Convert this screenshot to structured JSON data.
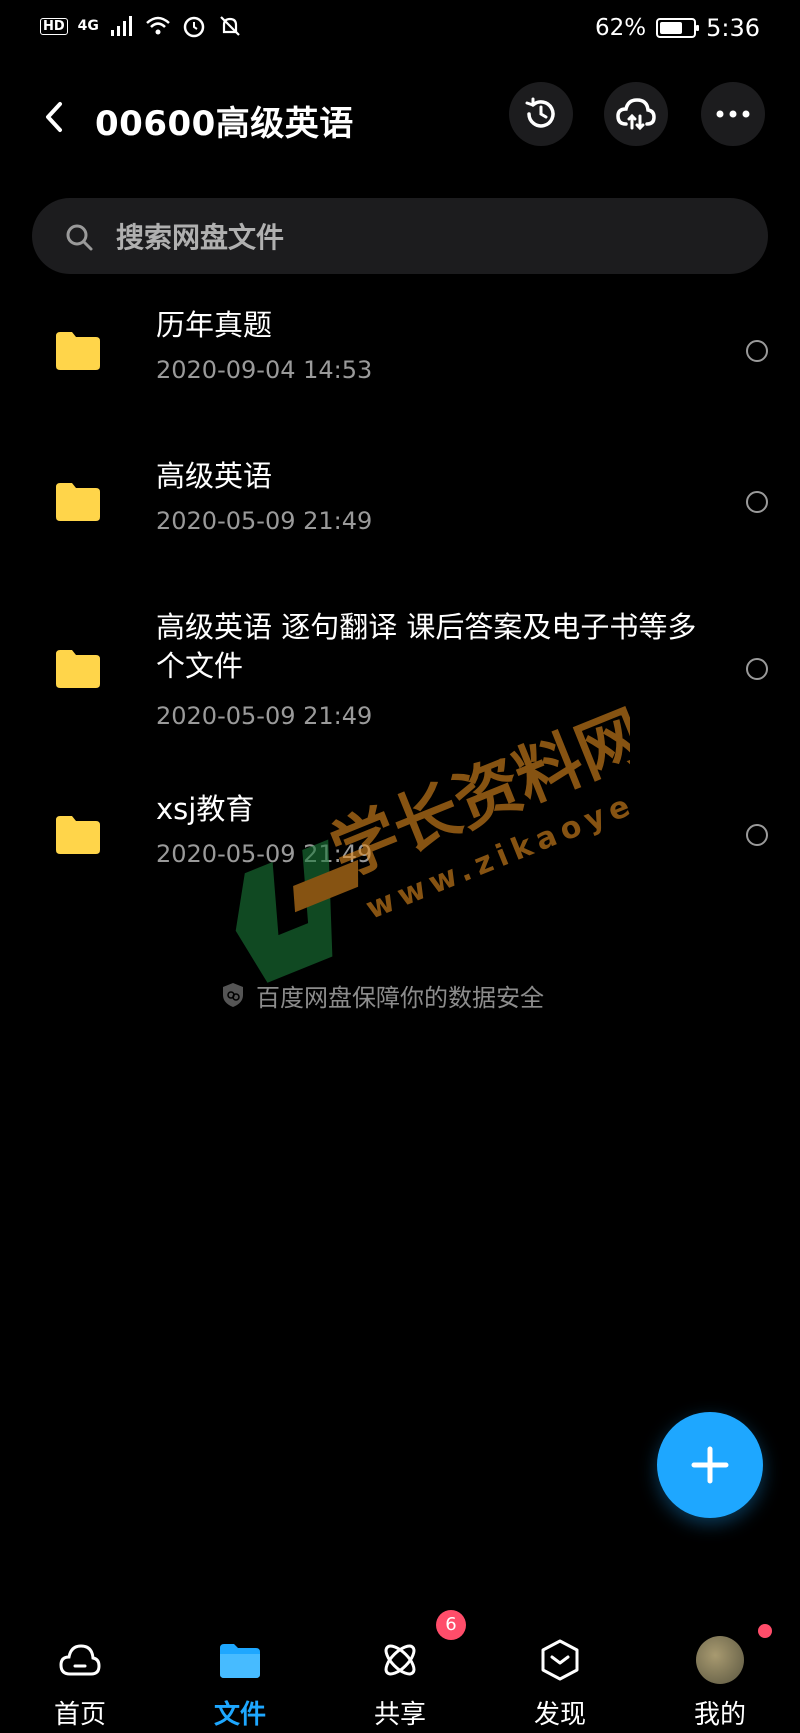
{
  "status_bar": {
    "hd": "HD",
    "net": "4G",
    "battery_pct": "62%",
    "battery_level": 0.62,
    "time": "5:36"
  },
  "header": {
    "title": "00600高级英语",
    "icons": [
      "back-icon",
      "history-icon",
      "cloud-transfer-icon",
      "more-icon"
    ]
  },
  "search": {
    "placeholder": "搜索网盘文件"
  },
  "files": [
    {
      "name": "历年真题",
      "date": "2020-09-04  14:53"
    },
    {
      "name": "高级英语",
      "date": "2020-05-09  21:49"
    },
    {
      "name": "高级英语 逐句翻译 课后答案及电子书等多个文件",
      "date": "2020-05-09  21:49"
    },
    {
      "name": "xsj教育",
      "date": "2020-05-09  21:49"
    }
  ],
  "footer_note": "百度网盘保障你的数据安全",
  "watermark": {
    "brand": "学长资料网",
    "url": "www.zikaoyes.com"
  },
  "nav": {
    "items": [
      {
        "label": "首页",
        "icon": "home-cloud-icon",
        "active": false
      },
      {
        "label": "文件",
        "icon": "folder-icon",
        "active": true
      },
      {
        "label": "共享",
        "icon": "share-atom-icon",
        "badge": "6"
      },
      {
        "label": "发现",
        "icon": "discover-icon"
      },
      {
        "label": "我的",
        "icon": "avatar"
      }
    ]
  },
  "colors": {
    "accent": "#1ea7ff",
    "folder": "#ffd54a",
    "badge": "#ff4d6a",
    "background": "#000000"
  }
}
